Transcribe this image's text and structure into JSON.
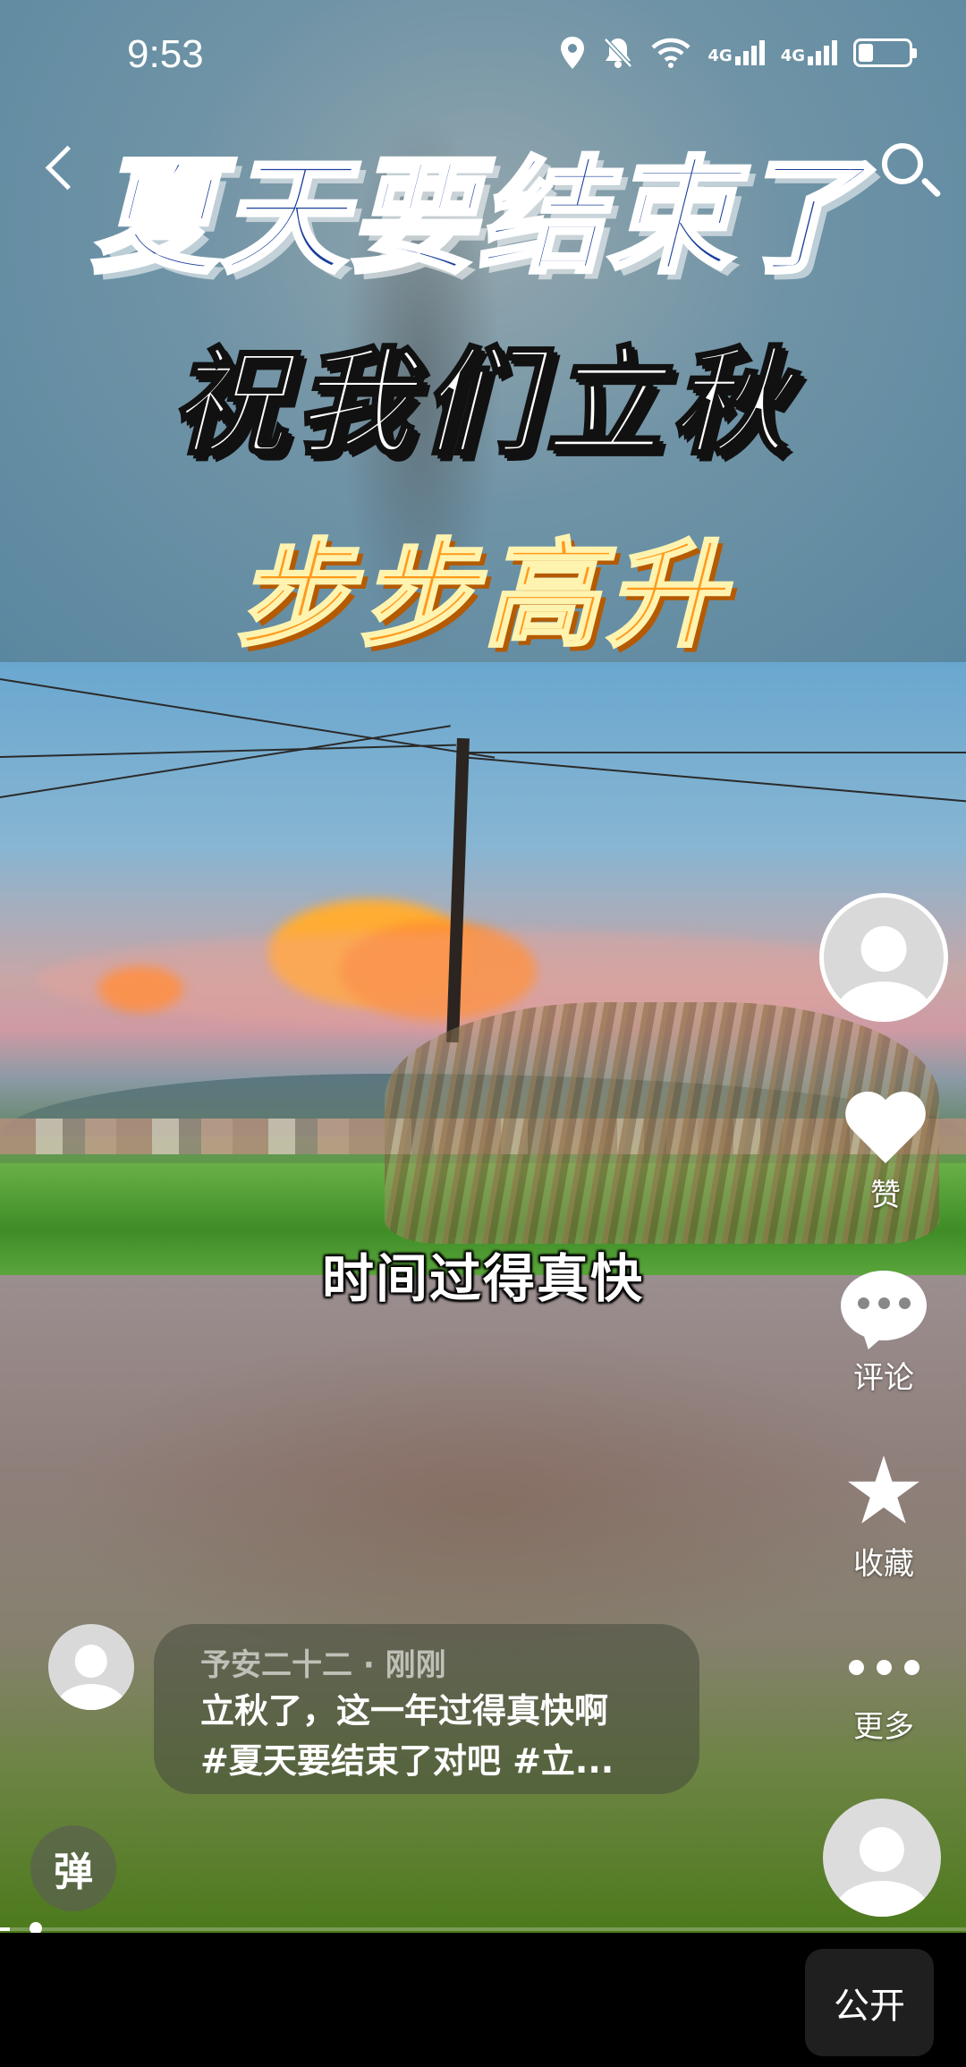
{
  "status_bar": {
    "time": "9:53",
    "network_1": "4G",
    "network_2": "4G"
  },
  "video": {
    "title_line1": "夏天要结束了",
    "title_line2": "祝我们立秋",
    "title_line3": "步步高升",
    "subtitle": "时间过得真快",
    "progress": 0.01
  },
  "right_rail": {
    "like_label": "赞",
    "comment_label": "评论",
    "favorite_label": "收藏",
    "more_label": "更多"
  },
  "caption": {
    "author": "予安二十二",
    "time": "刚刚",
    "meta": "予安二十二 · 刚刚",
    "line1": "立秋了，这一年过得真快啊",
    "line2": "#夏天要结束了对吧  #立..."
  },
  "danmu_label": "弹",
  "bottom_bar": {
    "public_label": "公开"
  },
  "icons": [
    "back-icon",
    "search-icon",
    "location-icon",
    "mute-icon",
    "wifi-icon",
    "battery-icon",
    "heart-icon",
    "comment-icon",
    "star-icon",
    "more-icon",
    "avatar-icon"
  ]
}
